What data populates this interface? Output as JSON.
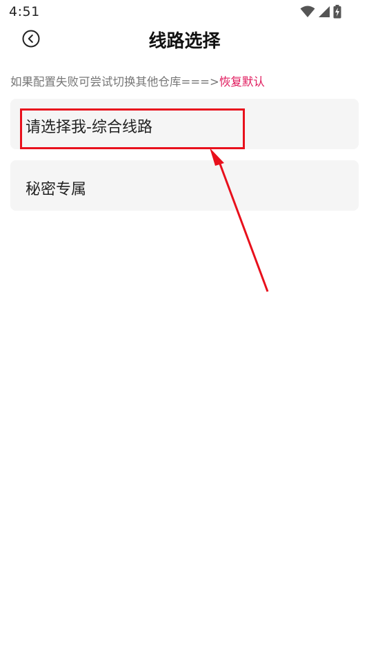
{
  "status_bar": {
    "time": "4:51",
    "icons": [
      "wifi-icon",
      "signal-icon",
      "battery-charging-icon"
    ]
  },
  "header": {
    "title": "线路选择",
    "back_icon": "back-circle-icon"
  },
  "hint": {
    "text": "如果配置失败可尝试切换其他仓库===>",
    "link_text": "恢复默认",
    "link_color": "#e0195c"
  },
  "routes": [
    {
      "label": "请选择我-综合线路"
    },
    {
      "label": "秘密专属"
    }
  ],
  "annotation": {
    "color": "#e8101c"
  }
}
